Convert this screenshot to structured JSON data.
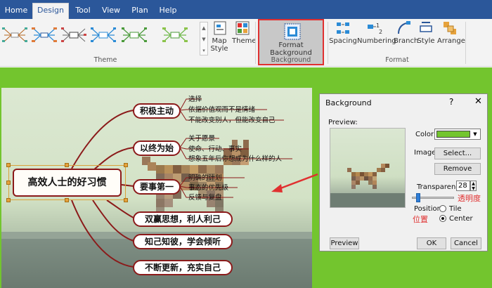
{
  "menu": {
    "tabs": [
      {
        "label": "Home",
        "active": false
      },
      {
        "label": "Design",
        "active": true
      },
      {
        "label": "Tool",
        "active": false
      },
      {
        "label": "View",
        "active": false
      },
      {
        "label": "Plan",
        "active": false
      },
      {
        "label": "Help",
        "active": false
      }
    ]
  },
  "ribbon": {
    "map_style": "Map Style",
    "theme": "Theme",
    "format_background": "Format Background",
    "spacing": "Spacing",
    "numbering": "Numbering",
    "branch": "Branch",
    "style": "Style",
    "arrange": "Arrange",
    "group_theme": "Theme",
    "group_background": "Background",
    "group_format": "Format"
  },
  "mindmap": {
    "central": "高效人士的好习惯",
    "topics": [
      {
        "label": "积极主动",
        "subs": [
          "选择",
          "依据价值观而不是情绪",
          "不能改变别人，但能改变自己"
        ]
      },
      {
        "label": "以终为始",
        "subs": [
          "关于愿景",
          "使命、行动、事实",
          "想象五年后你想成为什么样的人"
        ]
      },
      {
        "label": "要事第一",
        "subs": [
          "明确的计划",
          "事态的优先级",
          "反馈与复盘"
        ]
      },
      {
        "label": "双赢思想，利人利己",
        "subs": []
      },
      {
        "label": "知己知彼，学会倾听",
        "subs": []
      },
      {
        "label": "不断更新，充实自己",
        "subs": []
      }
    ]
  },
  "dialog": {
    "title": "Background",
    "help": "?",
    "close": "✕",
    "preview_label": "Preview:",
    "color_label": "Color:",
    "image_label": "Image:",
    "select_button": "Select...",
    "remove_button": "Remove",
    "transparency_label": "Transparency:",
    "transparency_value": "28",
    "position_label": "Position:",
    "position_options": [
      "Tile",
      "Center"
    ],
    "position_selected": "Center",
    "preview_button": "Preview",
    "ok_button": "OK",
    "cancel_button": "Cancel",
    "color_value": "#73c52e"
  },
  "annotations": {
    "transparency_note": "透明度",
    "position_note": "位置"
  },
  "colors": {
    "menubar": "#2b579a",
    "page_background": "#73c52e",
    "branch": "#8b1a1a",
    "highlight": "#e03030"
  }
}
